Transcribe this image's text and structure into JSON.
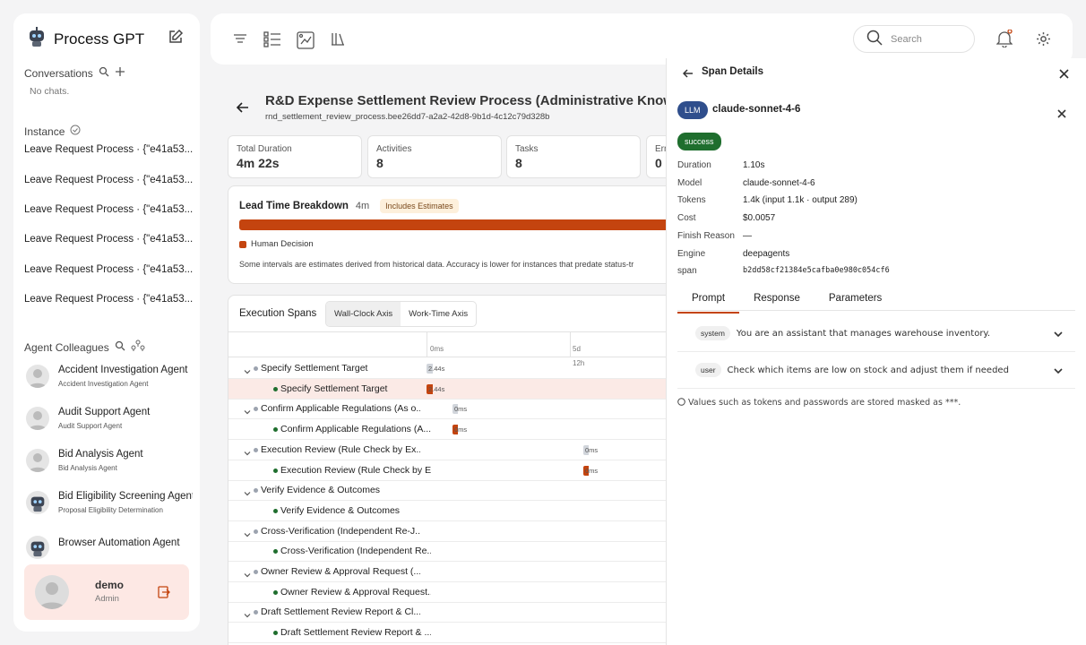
{
  "app": {
    "title": "Process GPT"
  },
  "sidebar": {
    "conversations_label": "Conversations",
    "no_chats": "No chats.",
    "instance_label": "Instance",
    "instances": [
      "Leave Request Process · {\"e41a53...",
      "Leave Request Process · {\"e41a53...",
      "Leave Request Process · {\"e41a53...",
      "Leave Request Process · {\"e41a53...",
      "Leave Request Process · {\"e41a53...",
      "Leave Request Process · {\"e41a53..."
    ],
    "agents_label": "Agent Colleagues",
    "agents": [
      {
        "name": "Accident Investigation Agent",
        "role": "Accident Investigation Agent"
      },
      {
        "name": "Audit Support Agent",
        "role": "Audit Support Agent"
      },
      {
        "name": "Bid Analysis Agent",
        "role": "Bid Analysis Agent"
      },
      {
        "name": "Bid Eligibility Screening Agent",
        "role": "Proposal Eligibility Determination"
      },
      {
        "name": "Browser Automation Agent",
        "role": ""
      }
    ],
    "user": {
      "name": "demo",
      "role": "Admin"
    }
  },
  "topbar": {
    "search_placeholder": "Search"
  },
  "process": {
    "title": "R&D Expense Settlement Review Process (Administrative Knowledge",
    "id": "rnd_settlement_review_process.bee26dd7-a2a2-42d8-9b1d-4c12c79d328b",
    "metrics": [
      {
        "label": "Total Duration",
        "value": "4m 22s"
      },
      {
        "label": "Activities",
        "value": "8"
      },
      {
        "label": "Tasks",
        "value": "8"
      },
      {
        "label": "Err",
        "value": "0"
      }
    ],
    "lead_time": {
      "title": "Lead Time Breakdown",
      "duration": "4m",
      "badge": "Includes Estimates",
      "legend": "Human Decision",
      "note": "Some intervals are estimates derived from historical data. Accuracy is lower for instances that predate status-tr"
    }
  },
  "spans": {
    "title": "Execution Spans",
    "axis_tabs": [
      "Wall-Clock Axis",
      "Work-Time Axis"
    ],
    "ticks": [
      "0ms",
      "5d",
      "12h"
    ],
    "rows": [
      {
        "name": "Specify Settlement Target",
        "level": 0,
        "bar_label": "2.44s"
      },
      {
        "name": "Specify Settlement Target",
        "level": 1,
        "bar_label": "2.44s"
      },
      {
        "name": "Confirm Applicable Regulations (As o...",
        "level": 0,
        "bar_label": "0ms"
      },
      {
        "name": "Confirm Applicable Regulations (A...",
        "level": 1,
        "bar_label": "0ms"
      },
      {
        "name": "Execution Review (Rule Check by Ex...",
        "level": 0,
        "bar_label": "0ms"
      },
      {
        "name": "Execution Review (Rule Check by E...",
        "level": 1,
        "bar_label": "0ms"
      },
      {
        "name": "Verify Evidence & Outcomes",
        "level": 0,
        "bar_label": ""
      },
      {
        "name": "Verify Evidence & Outcomes",
        "level": 1,
        "bar_label": ""
      },
      {
        "name": "Cross-Verification (Independent Re-J...",
        "level": 0,
        "bar_label": ""
      },
      {
        "name": "Cross-Verification (Independent Re...",
        "level": 1,
        "bar_label": ""
      },
      {
        "name": "Owner Review & Approval Request (...",
        "level": 0,
        "bar_label": ""
      },
      {
        "name": "Owner Review & Approval Request...",
        "level": 1,
        "bar_label": ""
      },
      {
        "name": "Draft Settlement Review Report & Cl...",
        "level": 0,
        "bar_label": ""
      },
      {
        "name": "Draft Settlement Review Report & ...",
        "level": 1,
        "bar_label": ""
      }
    ]
  },
  "span_details": {
    "title": "Span Details",
    "type_badge": "LLM",
    "model_name": "claude-sonnet-4-6",
    "status": "success",
    "fields": [
      {
        "key": "Duration",
        "value": "1.10s"
      },
      {
        "key": "Model",
        "value": "claude-sonnet-4-6"
      },
      {
        "key": "Tokens",
        "value": "1.4k (input 1.1k · output 289)"
      },
      {
        "key": "Cost",
        "value": "$0.0057"
      },
      {
        "key": "Finish Reason",
        "value": "—"
      },
      {
        "key": "Engine",
        "value": "deepagents"
      },
      {
        "key": "span",
        "value": "b2dd58cf21384e5cafba0e980c054cf6"
      }
    ],
    "tabs": [
      "Prompt",
      "Response",
      "Parameters"
    ],
    "messages": [
      {
        "role": "system",
        "text": "You are an assistant that manages warehouse inventory."
      },
      {
        "role": "user",
        "text": "Check which items are low on stock and adjust them if needed"
      }
    ],
    "note": "Values such as tokens and passwords are stored masked as ***."
  },
  "colors": {
    "accent": "#c4440f",
    "success": "#1f6e2e",
    "badge": "#2f4e8c"
  }
}
